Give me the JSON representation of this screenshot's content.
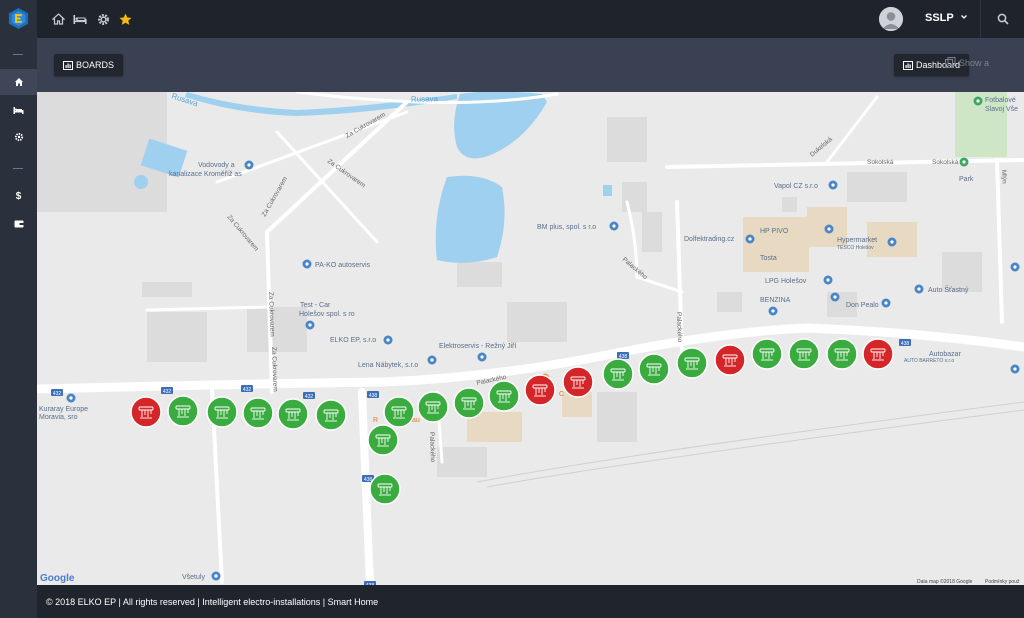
{
  "header": {
    "user_name": "SSLP",
    "top_icons": [
      "home-icon",
      "bed-icon",
      "gear-icon",
      "star-icon"
    ]
  },
  "sidebar": {
    "items": [
      {
        "icon": "home-icon",
        "active": true
      },
      {
        "icon": "bed-icon",
        "active": false
      },
      {
        "icon": "gear-icon",
        "active": false
      },
      {
        "icon": "dollar-icon",
        "active": false
      },
      {
        "icon": "wallet-icon",
        "active": false
      }
    ]
  },
  "toolbar": {
    "boards_label": "BOARDS",
    "dashboard_label": "Dashboard",
    "show_all_label": "Show a"
  },
  "map": {
    "labels": {
      "fotbalove": "Fotbalové",
      "slavoj": "Slavoj Vše",
      "rusava": "Rusava",
      "rusava2": "Rusava",
      "za_cukrovarem": "Za Cukrovarem",
      "za_cukrovarem2": "Za Cukrovarem",
      "za_cukrovarem3": "Za Cukrovarem",
      "za_cukrovarem4": "Za Cukrovarem",
      "za_cukrovarem5": "Za Cukrovarem",
      "za_cukrovarem6": "Za Cukrovarem",
      "vodovody1": "Vodovody a",
      "vodovody2": "kanalizace Kroměříž as",
      "dukelska": "Dukelská",
      "sokolska": "Sokolská",
      "sokolska2": "Sokolská",
      "park": "Park",
      "mlynska": "Mlýn",
      "vapol": "Vapol CZ s.r.o",
      "bm_plus": "BM plus, spol. s r.o",
      "hp_pivo": "HP PIVO",
      "dolfektrading": "Dolfektrading.cz",
      "hypermarket": "Hypermarket",
      "tesco": "TESCO Holešov",
      "tosta": "Tosta",
      "lpg": "LPG Holešov",
      "benzina": "BENZINA",
      "auto_stastny": "Auto Šťastný",
      "don_pealo": "Don Pealo",
      "pako": "PA-KO autoservis",
      "testcar1": "Test - Car",
      "testcar2": "Holešov spol. s ro",
      "elko": "ELKO EP, s.r.o",
      "elektroservis": "Elektroservis - Režný Jiří",
      "lena": "Lena Nábytek, s.r.o",
      "palackeho": "Palackého",
      "palackeho2": "Palackého",
      "palackeho3": "Palackého",
      "palackeho4": "Palackého",
      "autobazar": "Autobazar",
      "auto_barreto": "AUTO BARRETO s.r.o",
      "kuraray1": "Kuraray Europe",
      "kuraray2": "Moravia, sro",
      "r_cafe": "R",
      "cafe2": "C",
      "cafe3": "au",
      "vsetuly": "Všetuly",
      "google": "Google",
      "attribution": "Data map ©2018 Google",
      "terms": "Podmínky použ"
    },
    "road_shields": [
      "432",
      "432",
      "432",
      "432",
      "438",
      "438",
      "438",
      "438",
      "438"
    ],
    "boards": [
      {
        "status": "fault"
      },
      {
        "status": "ok"
      },
      {
        "status": "ok"
      },
      {
        "status": "ok"
      },
      {
        "status": "ok"
      },
      {
        "status": "ok"
      },
      {
        "status": "ok"
      },
      {
        "status": "ok"
      },
      {
        "status": "ok"
      },
      {
        "status": "ok"
      },
      {
        "status": "ok"
      },
      {
        "status": "fault"
      },
      {
        "status": "fault"
      },
      {
        "status": "ok"
      },
      {
        "status": "ok"
      },
      {
        "status": "ok"
      },
      {
        "status": "fault"
      },
      {
        "status": "ok"
      },
      {
        "status": "ok"
      },
      {
        "status": "ok"
      },
      {
        "status": "fault"
      },
      {
        "status": "ok"
      }
    ],
    "colors": {
      "ok": "#3aab3f",
      "fault": "#d42528",
      "water": "#9fd0f0",
      "road": "#ffffff",
      "poi": "#4a86c5"
    }
  },
  "footer": {
    "text": "© 2018 ELKO EP | All rights reserved | Intelligent electro-installations | Smart Home"
  }
}
